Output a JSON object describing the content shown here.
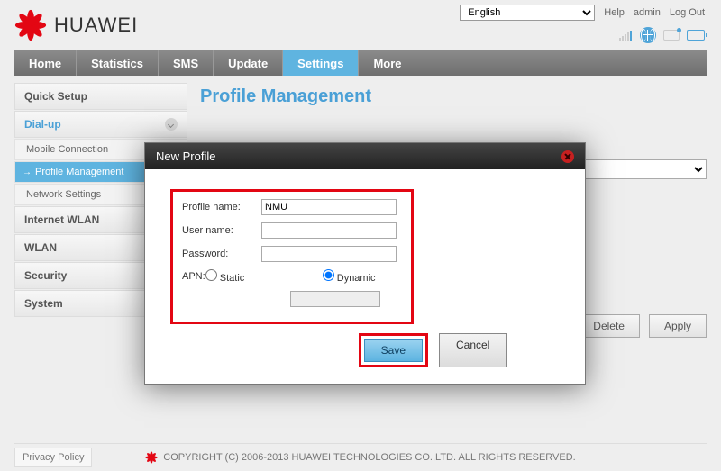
{
  "top": {
    "language_selected": "English",
    "help": "Help",
    "admin": "admin",
    "logout": "Log Out"
  },
  "brand": {
    "name": "HUAWEI"
  },
  "nav": {
    "items": [
      "Home",
      "Statistics",
      "SMS",
      "Update",
      "Settings",
      "More"
    ],
    "active_index": 4
  },
  "sidebar": {
    "quick_setup": "Quick Setup",
    "dialup": {
      "label": "Dial-up",
      "children": [
        "Mobile Connection",
        "Profile Management",
        "Network Settings"
      ],
      "active_child_index": 1
    },
    "internet_wlan": "Internet WLAN",
    "wlan": "WLAN",
    "security": "Security",
    "system": "System"
  },
  "page": {
    "title": "Profile Management",
    "delete": "Delete",
    "apply": "Apply"
  },
  "modal": {
    "title": "New Profile",
    "labels": {
      "profile_name": "Profile name:",
      "user_name": "User name:",
      "password": "Password:",
      "apn": "APN:",
      "static": "Static",
      "dynamic": "Dynamic"
    },
    "values": {
      "profile_name": "NMU",
      "user_name": "",
      "password": "",
      "apn_mode": "dynamic",
      "apn_value": ""
    },
    "save": "Save",
    "cancel": "Cancel"
  },
  "footer": {
    "privacy": "Privacy Policy",
    "copyright": "COPYRIGHT (C) 2006-2013 HUAWEI TECHNOLOGIES CO.,LTD. ALL RIGHTS RESERVED."
  }
}
